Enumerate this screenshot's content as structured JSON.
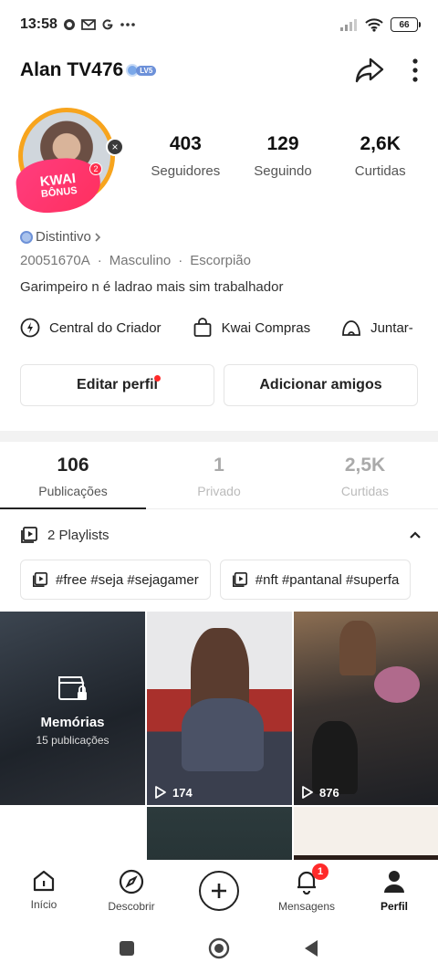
{
  "status_bar": {
    "time": "13:58",
    "notification_icons": [
      "whatsapp-icon",
      "gmail-icon",
      "google-icon",
      "more-dots-icon"
    ],
    "battery": "66"
  },
  "header": {
    "username": "Alan TV476",
    "level": "LV5"
  },
  "profile": {
    "kwai_bonus": {
      "line1": "KWAI",
      "line2": "BÔNUS",
      "count": "2"
    },
    "stats": [
      {
        "value": "403",
        "label": "Seguidores"
      },
      {
        "value": "129",
        "label": "Seguindo"
      },
      {
        "value": "2,6K",
        "label": "Curtidas"
      }
    ],
    "distintivo": "Distintivo",
    "meta": [
      "20051670A",
      "·",
      "Masculino",
      "·",
      "Escorpião"
    ],
    "bio": "Garimpeiro n é ladrao mais sim trabalhador"
  },
  "shortcuts": [
    {
      "label": "Central do Criador",
      "icon": "lightning-icon"
    },
    {
      "label": "Kwai Compras",
      "icon": "shopping-bag-icon"
    },
    {
      "label": "Juntar-",
      "icon": "tent-icon"
    }
  ],
  "actions": {
    "edit_profile": "Editar perfil",
    "add_friends": "Adicionar amigos"
  },
  "tabs": [
    {
      "count": "106",
      "label": "Publicações",
      "active": true
    },
    {
      "count": "1",
      "label": "Privado",
      "active": false
    },
    {
      "count": "2,5K",
      "label": "Curtidas",
      "active": false
    }
  ],
  "playlists": {
    "title": "2 Playlists",
    "items": [
      "#free #seja #sejagamer",
      "#nft #pantanal #superfa"
    ]
  },
  "grid": {
    "memories": {
      "title": "Memórias",
      "count": "15 publicações"
    },
    "plays": [
      "174",
      "876"
    ]
  },
  "bottom_nav": [
    {
      "label": "Início",
      "icon": "home-icon"
    },
    {
      "label": "Descobrir",
      "icon": "compass-icon"
    },
    {
      "label": "",
      "icon": "plus-icon"
    },
    {
      "label": "Mensagens",
      "icon": "bell-icon",
      "badge": "1"
    },
    {
      "label": "Perfil",
      "icon": "person-icon",
      "active": true
    }
  ]
}
